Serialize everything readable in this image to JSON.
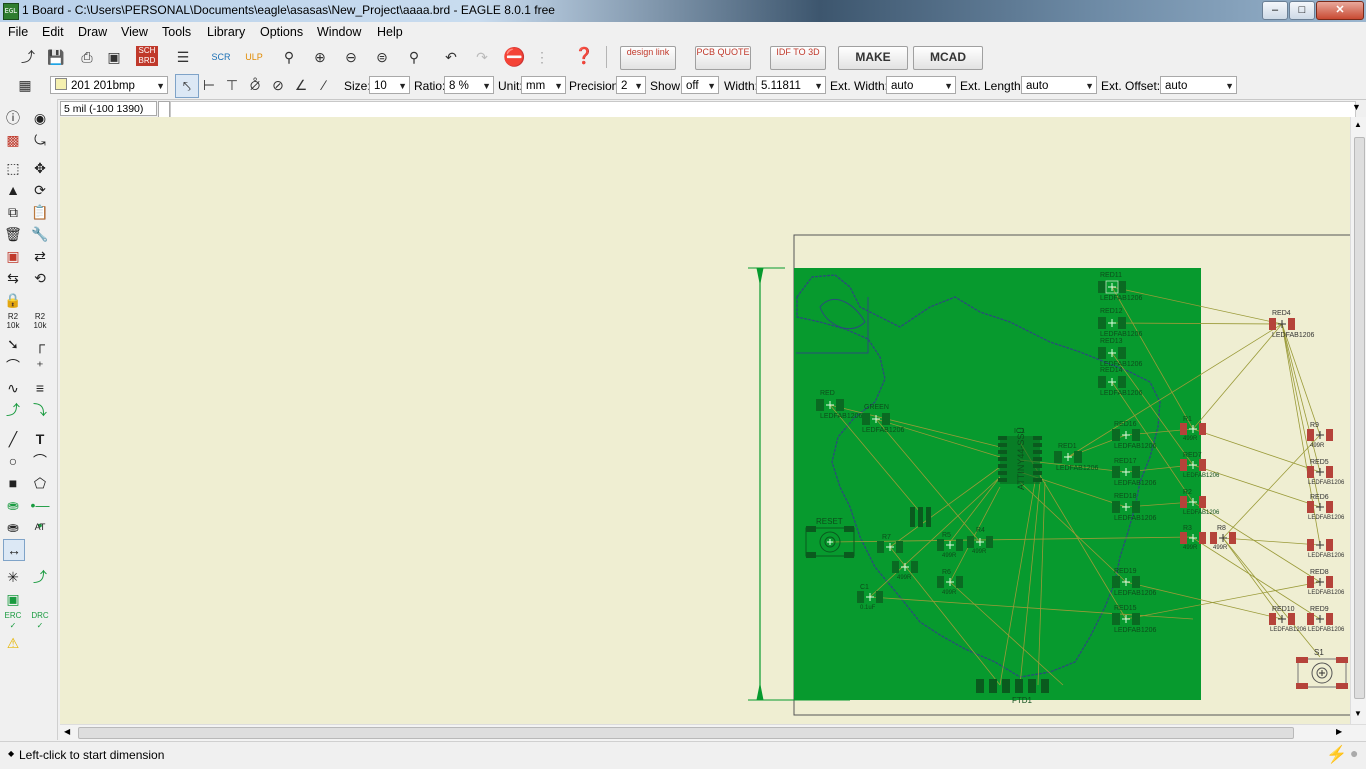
{
  "window": {
    "title": "1 Board - C:\\Users\\PERSONAL\\Documents\\eagle\\asasas\\New_Project\\aaaa.brd - EAGLE 8.0.1 free",
    "app_icon_text": "EGL"
  },
  "menu": [
    "File",
    "Edit",
    "Draw",
    "View",
    "Tools",
    "Library",
    "Options",
    "Window",
    "Help"
  ],
  "toolbar": {
    "vendor_buttons": [
      {
        "text": "design link"
      },
      {
        "text": "PCB QUOTE"
      },
      {
        "text": "IDF TO 3D"
      },
      {
        "text": "MAKE"
      },
      {
        "text": "MCAD"
      }
    ]
  },
  "params": {
    "layer": "201 201bmp",
    "size_label": "Size:",
    "size": "10",
    "ratio_label": "Ratio:",
    "ratio": "8 %",
    "unit_label": "Unit:",
    "unit": "mm",
    "precision_label": "Precision:",
    "precision": "2",
    "show_label": "Show:",
    "show": "off",
    "width_label": "Width:",
    "width": "5.11811",
    "ext_width_label": "Ext. Width:",
    "ext_width": "auto",
    "ext_length_label": "Ext. Length:",
    "ext_length": "auto",
    "ext_offset_label": "Ext. Offset:",
    "ext_offset": "auto"
  },
  "command": {
    "coords": "5 mil (-100 1390)",
    "input": ""
  },
  "status": {
    "message": "Left-click to start dimension"
  },
  "board": {
    "board_color": "#079a2e",
    "labels": {
      "red11": "RED11",
      "red12": "RED12",
      "red13": "RED13",
      "red14": "RED14",
      "red4": "RED4",
      "red0": "RED",
      "green": "GREEN",
      "ic1": "IC1",
      "attiny": "ATTINY44-SSU",
      "red1": "RED1",
      "red16": "RED16",
      "red17": "RED17",
      "red18": "RED18",
      "red19": "RED19",
      "red15": "RED15",
      "red5": "RED5",
      "red6": "RED6",
      "red7": "RED7",
      "red8": "RED8",
      "red9": "RED9",
      "red10": "RED10",
      "r9": "R9",
      "r8": "R8",
      "r1": "R1",
      "r2": "R2",
      "r3": "R3",
      "r4": "R4",
      "r5": "R5",
      "r6": "R6",
      "r7": "R7",
      "reset": "RESET",
      "s1": "S1",
      "c1": "C1",
      "ftd1": "FTD1",
      "pkg": "LEDFAB1206",
      "res_val": "499R",
      "cap_val": "0.1uF"
    }
  }
}
